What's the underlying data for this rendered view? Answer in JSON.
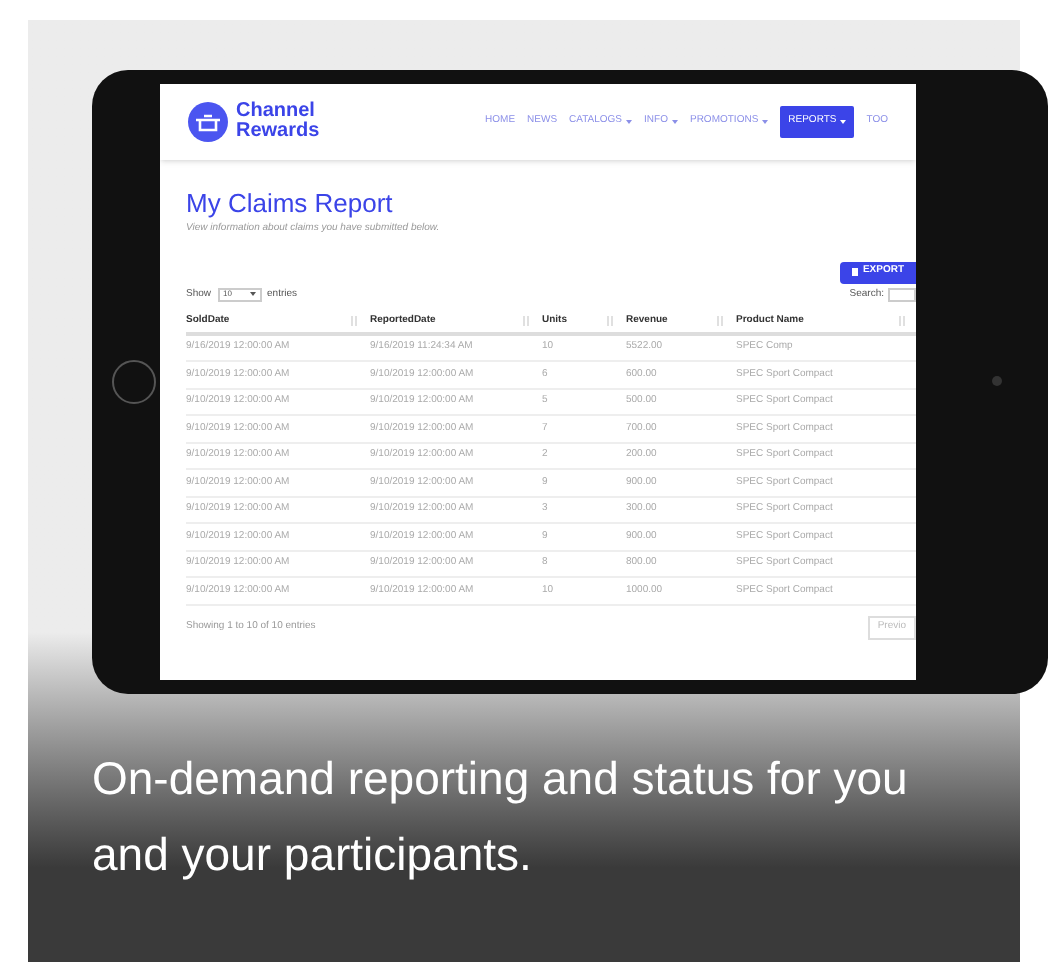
{
  "brand": {
    "line_1": "Channel",
    "line_2": "Rewards"
  },
  "nav": [
    {
      "label": "HOME",
      "dropdown": false,
      "selected": false
    },
    {
      "label": "NEWS",
      "dropdown": false,
      "selected": false
    },
    {
      "label": "CATALOGS",
      "dropdown": true,
      "selected": false
    },
    {
      "label": "INFO",
      "dropdown": true,
      "selected": false
    },
    {
      "label": "PROMOTIONS",
      "dropdown": true,
      "selected": false
    },
    {
      "label": "REPORTS",
      "dropdown": true,
      "selected": true
    },
    {
      "label": "TOO",
      "dropdown": false,
      "selected": false
    }
  ],
  "page": {
    "title": "My Claims Report",
    "subtitle": "View information about claims you have submitted below.",
    "export_button": "EXPORT"
  },
  "length_menu": {
    "before": "Show",
    "value": "10",
    "after": "entries"
  },
  "search": {
    "label": "Search:"
  },
  "table": {
    "columns": [
      "SoldDate",
      "ReportedDate",
      "Units",
      "Revenue",
      "Product Name"
    ],
    "rows": [
      [
        "9/16/2019 12:00:00 AM",
        "9/16/2019 11:24:34 AM",
        "10",
        "5522.00",
        "SPEC Comp"
      ],
      [
        "9/10/2019 12:00:00 AM",
        "9/10/2019 12:00:00 AM",
        "6",
        "600.00",
        "SPEC Sport Compact"
      ],
      [
        "9/10/2019 12:00:00 AM",
        "9/10/2019 12:00:00 AM",
        "5",
        "500.00",
        "SPEC Sport Compact"
      ],
      [
        "9/10/2019 12:00:00 AM",
        "9/10/2019 12:00:00 AM",
        "7",
        "700.00",
        "SPEC Sport Compact"
      ],
      [
        "9/10/2019 12:00:00 AM",
        "9/10/2019 12:00:00 AM",
        "2",
        "200.00",
        "SPEC Sport Compact"
      ],
      [
        "9/10/2019 12:00:00 AM",
        "9/10/2019 12:00:00 AM",
        "9",
        "900.00",
        "SPEC Sport Compact"
      ],
      [
        "9/10/2019 12:00:00 AM",
        "9/10/2019 12:00:00 AM",
        "3",
        "300.00",
        "SPEC Sport Compact"
      ],
      [
        "9/10/2019 12:00:00 AM",
        "9/10/2019 12:00:00 AM",
        "9",
        "900.00",
        "SPEC Sport Compact"
      ],
      [
        "9/10/2019 12:00:00 AM",
        "9/10/2019 12:00:00 AM",
        "8",
        "800.00",
        "SPEC Sport Compact"
      ],
      [
        "9/10/2019 12:00:00 AM",
        "9/10/2019 12:00:00 AM",
        "10",
        "1000.00",
        "SPEC Sport Compact"
      ]
    ]
  },
  "info": "Showing 1 to 10 of 10 entries",
  "pager": {
    "previous": "Previo"
  },
  "caption": "On-demand reporting and status for you and your participants."
}
